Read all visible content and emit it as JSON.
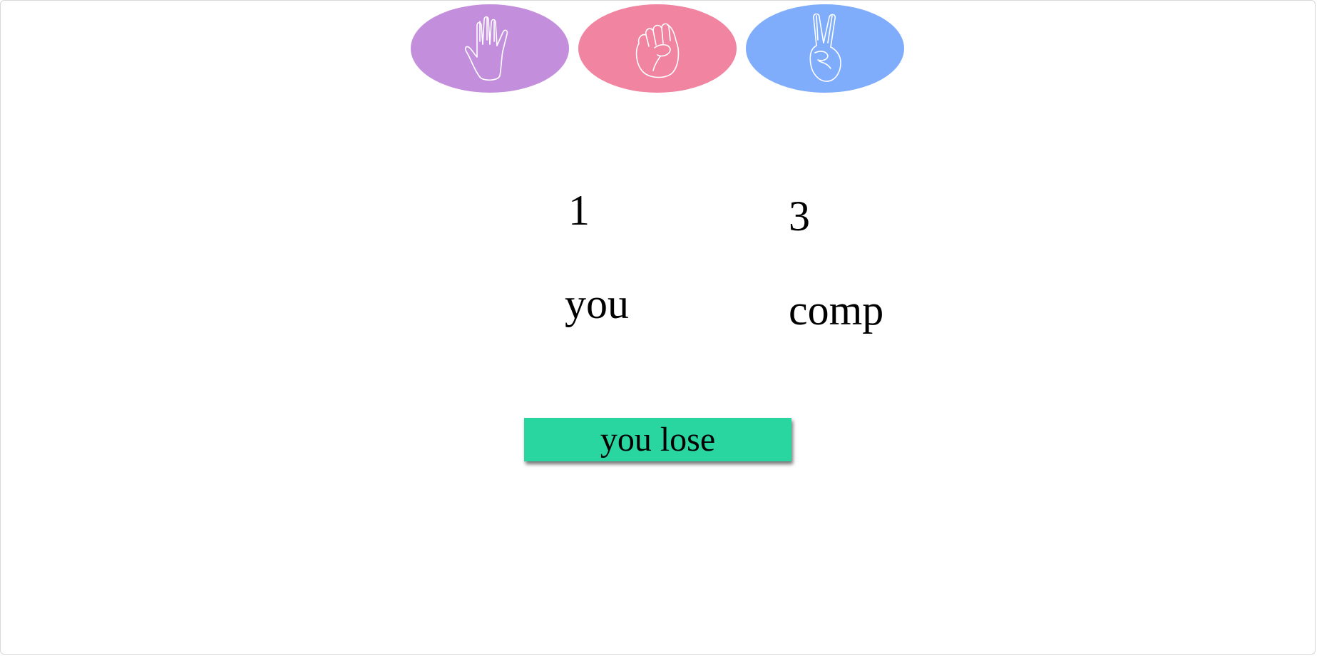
{
  "choices": [
    {
      "name": "paper",
      "icon": "paper-hand-icon",
      "color": "#c38fdd"
    },
    {
      "name": "rock",
      "icon": "rock-fist-icon",
      "color": "#f084a1"
    },
    {
      "name": "scissors",
      "icon": "scissors-peace-icon",
      "color": "#80adfb"
    }
  ],
  "scoreboard": {
    "you_score": "1",
    "comp_score": "3",
    "you_label": "you",
    "comp_label": "comp"
  },
  "result": {
    "text": "you lose",
    "color": "#2ad69f"
  }
}
